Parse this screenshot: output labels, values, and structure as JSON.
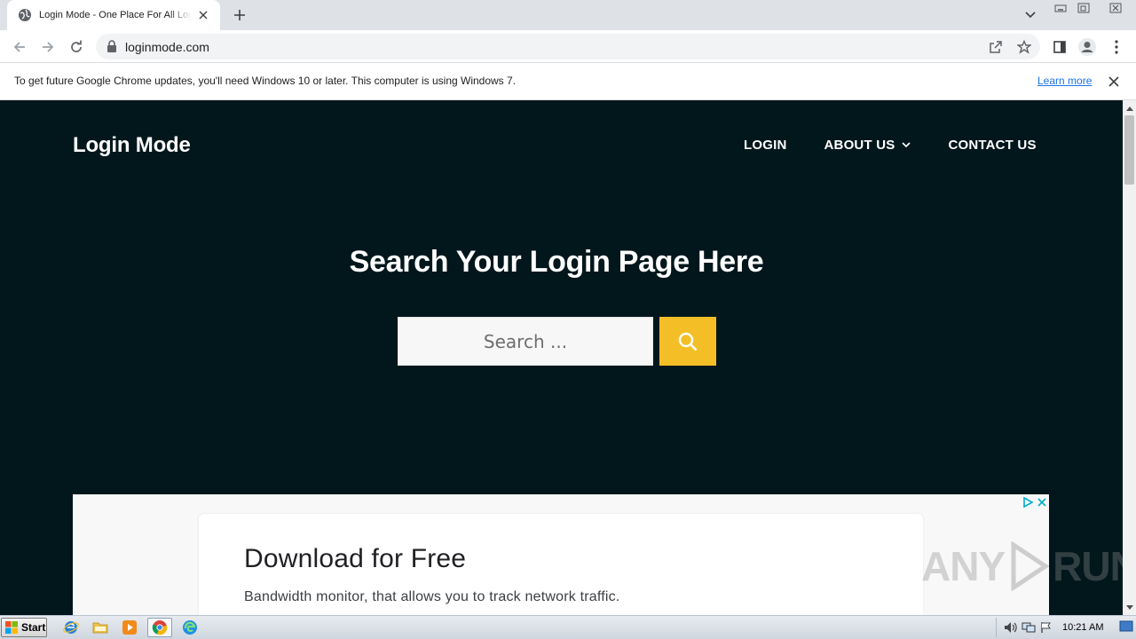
{
  "browser": {
    "tab": {
      "title": "Login Mode - One Place For All Login Pages"
    },
    "address_bar": {
      "url": "loginmode.com"
    }
  },
  "infobar": {
    "message": "To get future Google Chrome updates, you'll need Windows 10 or later. This computer is using Windows 7.",
    "link": "Learn more"
  },
  "site": {
    "logo": "Login Mode",
    "nav": {
      "login": "LOGIN",
      "about": "ABOUT US",
      "contact": "CONTACT US"
    },
    "hero_title": "Search Your Login Page Here",
    "search": {
      "placeholder": "Search ..."
    },
    "ad": {
      "title": "Download for Free",
      "description": "Bandwidth monitor, that allows you to track network traffic."
    },
    "watermark_left": "ANY",
    "watermark_right": "RUN"
  },
  "taskbar": {
    "start_label": "Start",
    "clock": "10:21 AM"
  },
  "colors": {
    "site_background": "#02171c",
    "search_button": "#f4bf26",
    "link": "#1a73e8"
  }
}
